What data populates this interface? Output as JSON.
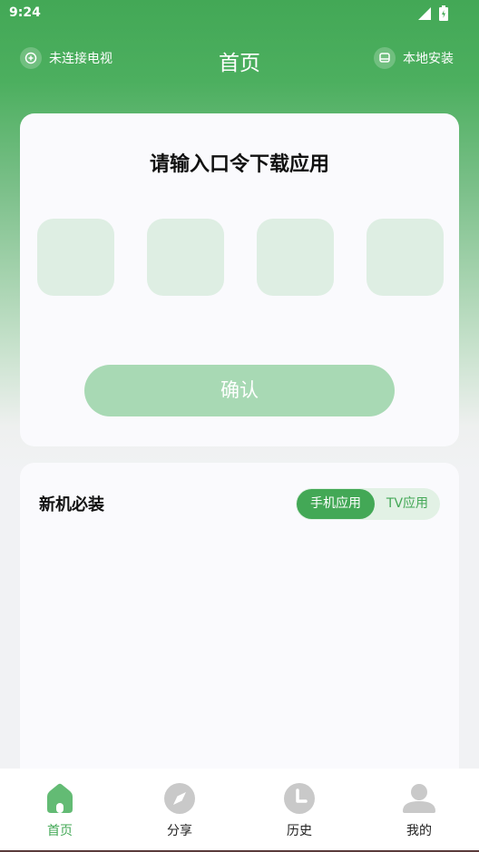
{
  "status_bar": {
    "time": "9:24"
  },
  "header": {
    "left_label": "未连接电视",
    "title": "首页",
    "right_label": "本地安装"
  },
  "code_card": {
    "title": "请输入口令下载应用",
    "confirm_label": "确认"
  },
  "new_device_card": {
    "title": "新机必装",
    "tabs": [
      {
        "label": "手机应用",
        "active": true
      },
      {
        "label": "TV应用",
        "active": false
      }
    ]
  },
  "bottom_nav": {
    "items": [
      {
        "label": "首页",
        "icon": "home-icon",
        "active": true
      },
      {
        "label": "分享",
        "icon": "compass-icon",
        "active": false
      },
      {
        "label": "历史",
        "icon": "clock-icon",
        "active": false
      },
      {
        "label": "我的",
        "icon": "person-icon",
        "active": false
      }
    ]
  },
  "colors": {
    "accent": "#43a856",
    "accent_light": "#a8d9b4",
    "code_box": "#deeee3",
    "inactive_icon": "#c9c9c9"
  }
}
